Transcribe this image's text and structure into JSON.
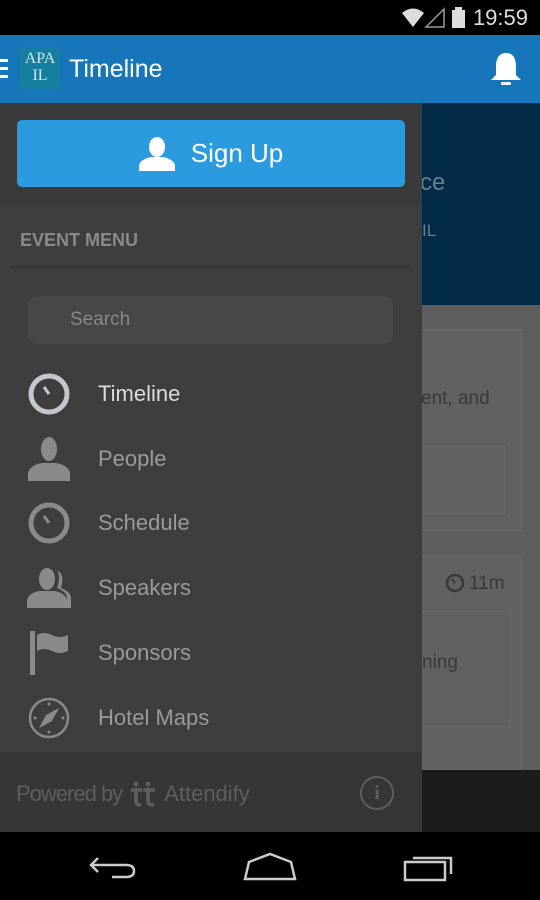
{
  "status_bar": {
    "time": "19:59",
    "icons": [
      "wifi-icon",
      "signal-icon",
      "battery-icon"
    ]
  },
  "app_bar": {
    "title": "Timeline",
    "logo_text_top": "APA",
    "logo_text_bottom": "IL",
    "icons": [
      "menu-icon",
      "bell-icon"
    ]
  },
  "background": {
    "hero_text_1": "ce",
    "hero_text_2": "IL",
    "card_text_1": "ent, and",
    "time_ago": "11m",
    "card_text_2": "ning"
  },
  "drawer": {
    "signup_label": "Sign Up",
    "section_title": "EVENT MENU",
    "search_placeholder": "Search",
    "items": [
      {
        "label": "Timeline",
        "icon": "clock-icon",
        "active": true
      },
      {
        "label": "People",
        "icon": "person-icon"
      },
      {
        "label": "Schedule",
        "icon": "clock-icon"
      },
      {
        "label": "Speakers",
        "icon": "people-icon"
      },
      {
        "label": "Sponsors",
        "icon": "flag-icon"
      },
      {
        "label": "Hotel Maps",
        "icon": "compass-icon"
      }
    ],
    "footer": {
      "powered_by": "Powered by",
      "brand": "Attendify"
    }
  },
  "colors": {
    "app_bar": "#1776b9",
    "signup_button": "#2b9ade",
    "drawer": "#3e3e3e"
  }
}
